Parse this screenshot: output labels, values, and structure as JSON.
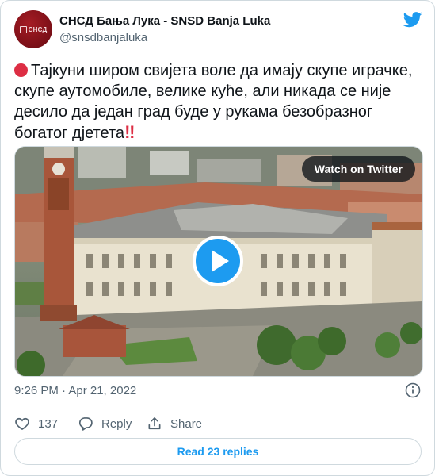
{
  "author": {
    "display_name": "СНСД Бања Лука - SNSD Banja Luka",
    "handle": "@snsdbanjaluka",
    "avatar_text": "СНСД",
    "avatar_color": "#8b141b"
  },
  "icons": {
    "brand": "twitter-bird-icon",
    "prefix": "red-circle-icon",
    "suffix": "double-exclamation-icon",
    "info": "info-icon",
    "like": "heart-icon",
    "reply": "reply-bubble-icon",
    "share": "share-icon",
    "play": "play-icon"
  },
  "tweet": {
    "text": "Тајкуни широм свијета воле да имају скупе играчке, скупе аутомобиле, велике куће, али никада се није десило да један град буде у рукама безобразног богатог дјетета",
    "suffix_symbol": "‼"
  },
  "media": {
    "watch_label": "Watch on Twitter"
  },
  "meta": {
    "timestamp": "9:26 PM · Apr 21, 2022"
  },
  "actions": {
    "like_count": "137",
    "reply_label": "Reply",
    "share_label": "Share"
  },
  "footer": {
    "read_replies_label": "Read 23 replies"
  },
  "colors": {
    "accent": "#1d9bf0",
    "text_primary": "#0f1419",
    "text_secondary": "#536471",
    "border": "#cfd9de",
    "emoji_red": "#dd2e44"
  }
}
